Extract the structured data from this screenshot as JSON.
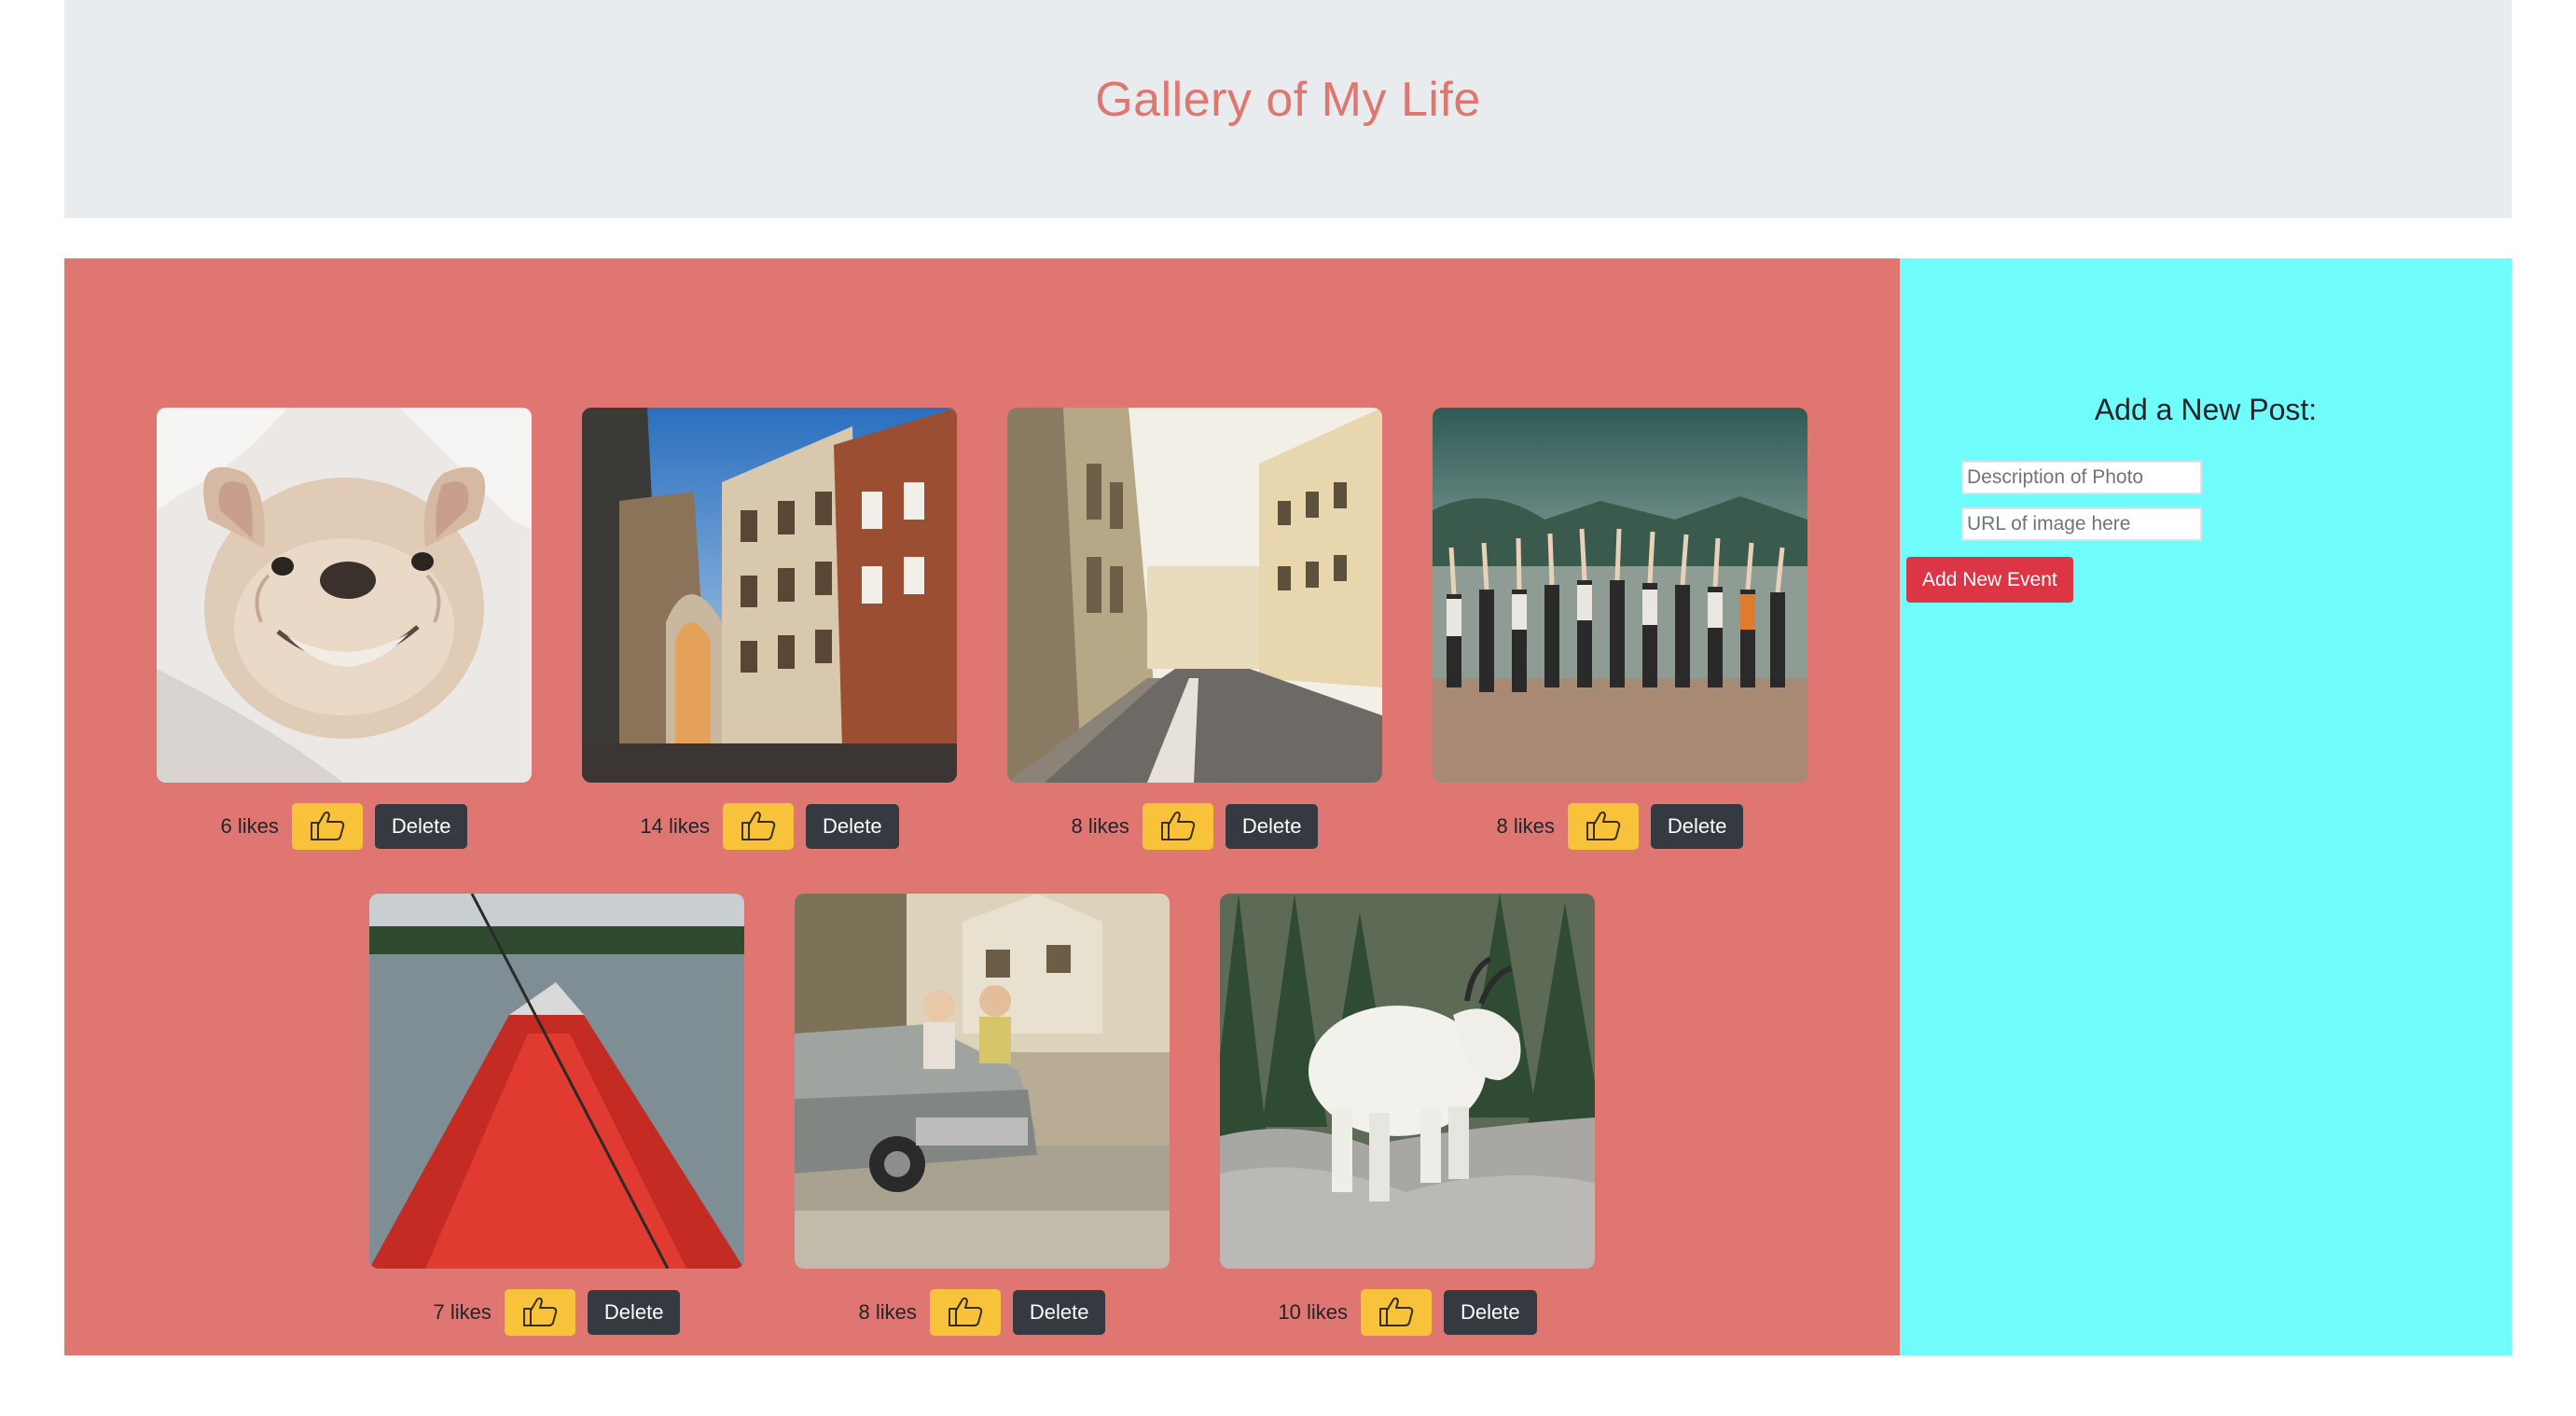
{
  "header": {
    "title": "Gallery of My Life"
  },
  "gallery": {
    "posts": [
      {
        "description": "French bulldog puppy smiling",
        "likes": "6 likes",
        "like_icon": "thumbs-up-icon",
        "delete_label": "Delete"
      },
      {
        "description": "Narrow street with stone archway",
        "likes": "14 likes",
        "like_icon": "thumbs-up-icon",
        "delete_label": "Delete"
      },
      {
        "description": "Parisian street with buildings",
        "likes": "8 likes",
        "like_icon": "thumbs-up-icon",
        "delete_label": "Delete"
      },
      {
        "description": "Group doing yoga by a river",
        "likes": "8 likes",
        "like_icon": "thumbs-up-icon",
        "delete_label": "Delete"
      },
      {
        "description": "Red canoe bow on a lake",
        "likes": "7 likes",
        "like_icon": "thumbs-up-icon",
        "delete_label": "Delete"
      },
      {
        "description": "Kids sitting on a vintage car",
        "likes": "8 likes",
        "like_icon": "thumbs-up-icon",
        "delete_label": "Delete"
      },
      {
        "description": "Mountain goat on rocks",
        "likes": "10 likes",
        "like_icon": "thumbs-up-icon",
        "delete_label": "Delete"
      }
    ]
  },
  "sidebar": {
    "title": "Add a New Post:",
    "description_placeholder": "Description of Photo",
    "url_placeholder": "URL of image here",
    "submit_label": "Add New Event"
  },
  "colors": {
    "header_bg": "#e9ecef",
    "title_color": "#e07670",
    "gallery_bg": "#df7671",
    "sidebar_bg": "#6ffcfa",
    "like_button": "#f8c33a",
    "delete_button": "#343a40",
    "submit_button": "#dc3545"
  }
}
